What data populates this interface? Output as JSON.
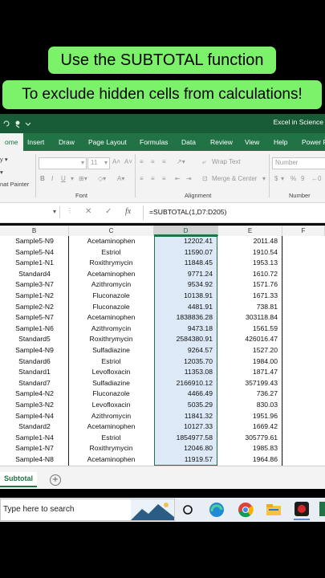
{
  "captions": {
    "line1": "Use the SUBTOTAL function",
    "line2": "To exclude hidden cells from calculations!"
  },
  "window": {
    "title": "Excel in Science"
  },
  "tabs": [
    {
      "label": "ome"
    },
    {
      "label": "Insert"
    },
    {
      "label": "Draw"
    },
    {
      "label": "Page Layout"
    },
    {
      "label": "Formulas"
    },
    {
      "label": "Data"
    },
    {
      "label": "Review"
    },
    {
      "label": "View"
    },
    {
      "label": "Help"
    },
    {
      "label": "Power P"
    }
  ],
  "ribbon": {
    "clipboard_label": "nat Painter",
    "font_size": "11",
    "font_group": "Font",
    "alignment_group": "Alignment",
    "number_group": "Number",
    "wrap_text": "Wrap Text",
    "merge_center": "Merge & Center",
    "number_format": "Number",
    "bold": "B",
    "italic": "I",
    "underline": "U",
    "currency": "$",
    "percent": "%"
  },
  "formula_bar": {
    "fx": "fx",
    "formula": "=SUBTOTAL(1,D7:D205)"
  },
  "columns": [
    "B",
    "C",
    "D",
    "E",
    "F"
  ],
  "rows": [
    [
      "Sample5-N9",
      "Acetaminophen",
      "12202.41",
      "2011.48"
    ],
    [
      "Sample5-N4",
      "Estriol",
      "11590.07",
      "1910.54"
    ],
    [
      "Sample1-N1",
      "Roxithrymycin",
      "11848.45",
      "1953.13"
    ],
    [
      "Standard4",
      "Acetaminophen",
      "9771.24",
      "1610.72"
    ],
    [
      "Sample3-N7",
      "Azithromycin",
      "9534.92",
      "1571.76"
    ],
    [
      "Sample1-N2",
      "Fluconazole",
      "10138.91",
      "1671.33"
    ],
    [
      "Sample2-N2",
      "Fluconazole",
      "4481.91",
      "738.81"
    ],
    [
      "Sample5-N7",
      "Acetaminophen",
      "1838836.28",
      "303118.84"
    ],
    [
      "Sample1-N6",
      "Azithromycin",
      "9473.18",
      "1561.59"
    ],
    [
      "Standard5",
      "Roxithrymycin",
      "2584380.91",
      "426016.47"
    ],
    [
      "Sample4-N9",
      "Sulfadiazine",
      "9264.57",
      "1527.20"
    ],
    [
      "Standard6",
      "Estriol",
      "12035.70",
      "1984.00"
    ],
    [
      "Standard1",
      "Levofloxacin",
      "11353.08",
      "1871.47"
    ],
    [
      "Standard7",
      "Sulfadiazine",
      "2166910.12",
      "357199.43"
    ],
    [
      "Sample4-N2",
      "Fluconazole",
      "4466.49",
      "736.27"
    ],
    [
      "Sample3-N2",
      "Levofloxacin",
      "5035.29",
      "830.03"
    ],
    [
      "Sample4-N4",
      "Azithromycin",
      "11841.32",
      "1951.96"
    ],
    [
      "Standard2",
      "Acetaminophen",
      "10127.33",
      "1669.42"
    ],
    [
      "Sample1-N4",
      "Estriol",
      "1854977.58",
      "305779.61"
    ],
    [
      "Sample1-N7",
      "Roxithrymycin",
      "12046.80",
      "1985.83"
    ],
    [
      "Sample4-N8",
      "Acetaminophen",
      "11919.57",
      "1964.86"
    ]
  ],
  "sheet": {
    "tab": "Subtotal",
    "add": "+"
  },
  "taskbar": {
    "search_placeholder": "Type here to search"
  },
  "colors": {
    "caption_bg": "#7cf26a",
    "excel_green": "#217346",
    "excel_dark_green": "#185c37",
    "selection_fill": "#dde9f7"
  }
}
